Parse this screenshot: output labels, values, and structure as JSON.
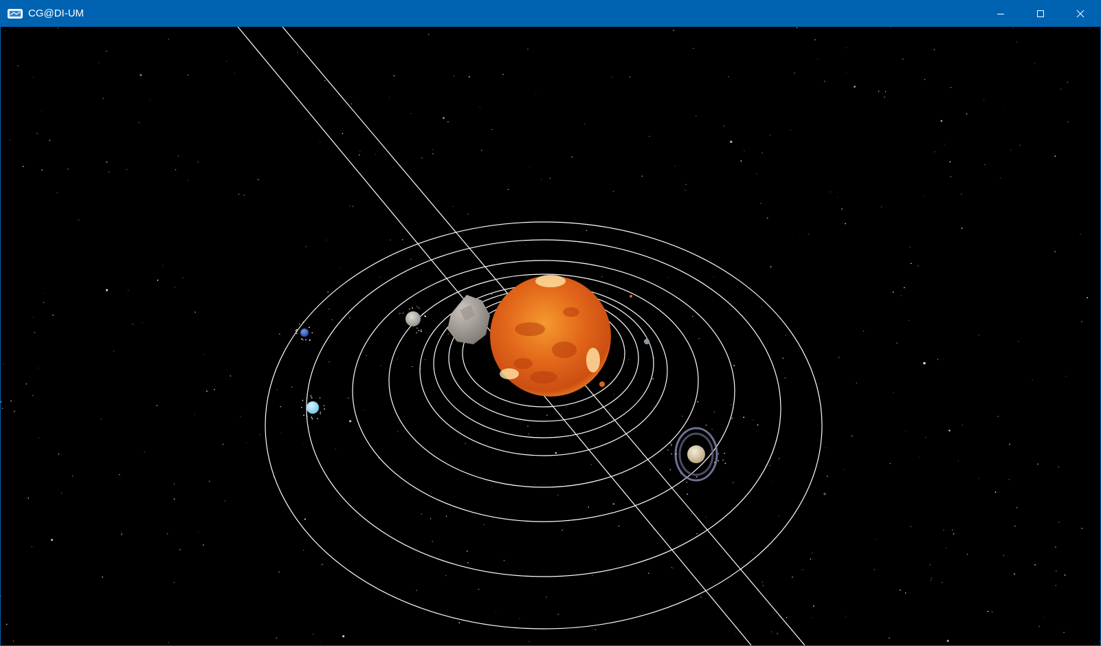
{
  "window": {
    "title": "CG@DI-UM",
    "controls": {
      "minimize": "minimize-icon",
      "maximize": "maximize-icon",
      "close": "close-icon"
    },
    "accent_color": "#0063b1"
  },
  "scene": {
    "background_color": "#000000",
    "orbit_line_color": "#ffffff",
    "sun_color": "#e8641a",
    "bodies": [
      "sun",
      "asteroid",
      "planet-gray",
      "planet-blue",
      "planet-cyan",
      "planet-ringed",
      "planet-small-orange",
      "planet-small-gray"
    ]
  }
}
